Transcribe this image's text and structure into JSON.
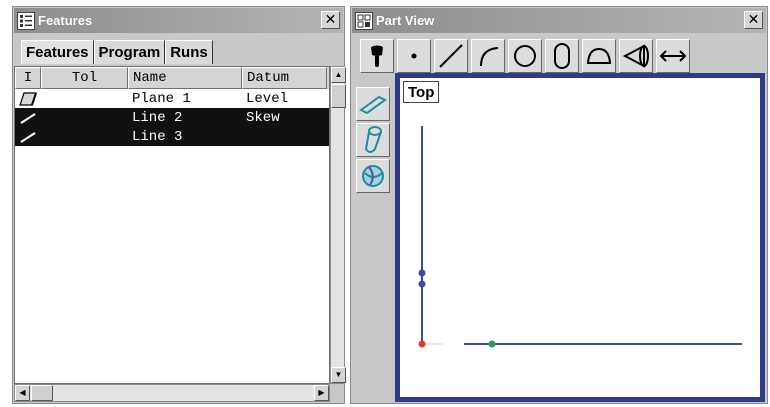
{
  "features_window": {
    "title": "Features",
    "close_glyph": "✕",
    "tabs": [
      "Features",
      "Program",
      "Runs"
    ],
    "columns": [
      "I",
      "Tol",
      "Name",
      "Datum"
    ],
    "rows": [
      {
        "icon": "plane-icon",
        "tol": "",
        "name": "Plane 1",
        "datum": "Level",
        "selected": false
      },
      {
        "icon": "line-icon",
        "tol": "",
        "name": "Line 2",
        "datum": "Skew",
        "selected": true
      },
      {
        "icon": "line-icon",
        "tol": "",
        "name": "Line 3",
        "datum": "",
        "selected": true
      }
    ]
  },
  "partview_window": {
    "title": "Part View",
    "close_glyph": "✕",
    "toolbar_icons": [
      "probe-icon",
      "point-icon",
      "line-icon",
      "arc-icon",
      "circle-icon",
      "slot-icon",
      "arc-segment-icon",
      "cone-icon",
      "distance-icon"
    ],
    "side_icons": [
      "plane-icon",
      "cylinder-icon",
      "sphere-icon"
    ],
    "view_label": "Top"
  },
  "colors": {
    "viewport_border": "#2f3a8c",
    "feature_line": "#3b4aa8",
    "origin_point": "#e03c2c",
    "green_point": "#2a9a5a",
    "selection": "#111111"
  }
}
